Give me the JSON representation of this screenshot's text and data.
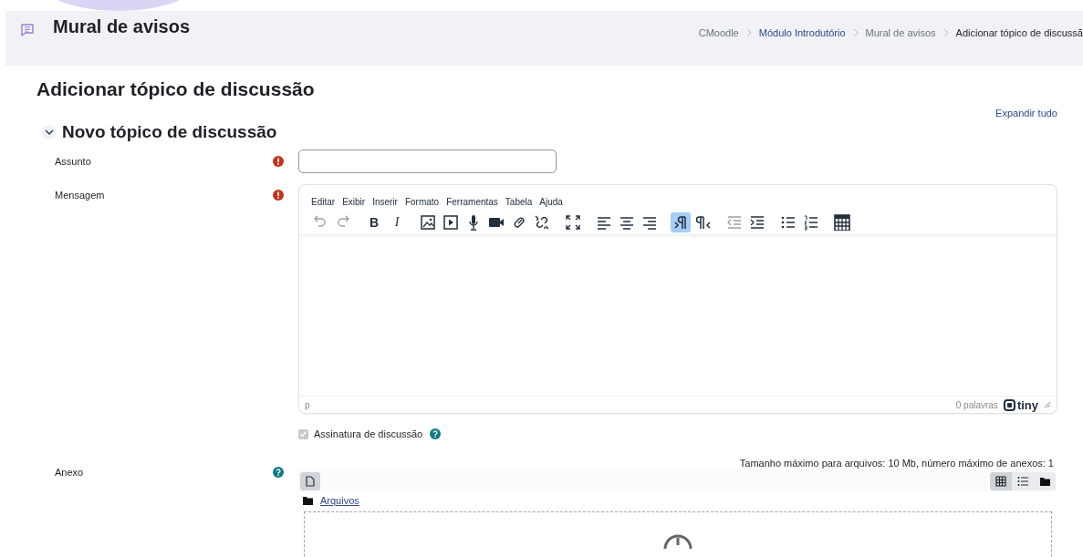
{
  "page_header": {
    "title": "Mural de avisos",
    "breadcrumb": [
      {
        "label": "CMoodle",
        "kind": "plain"
      },
      {
        "label": "Módulo Introdutório",
        "kind": "link"
      },
      {
        "label": "Mural de avisos",
        "kind": "plain"
      },
      {
        "label": "Adicionar tópico de discussã",
        "kind": "current"
      }
    ]
  },
  "heading": "Adicionar tópico de discussão",
  "expand_all": "Expandir tudo",
  "section": {
    "title": "Novo tópico de discussão",
    "expanded": true
  },
  "subject": {
    "label": "Assunto",
    "required": true
  },
  "message": {
    "label": "Mensagem",
    "required": true,
    "menus": [
      "Editar",
      "Exibir",
      "Inserir",
      "Formato",
      "Ferramentas",
      "Tabela",
      "Ajuda"
    ],
    "toolbar": [
      [
        {
          "kind": "undo",
          "disabled": true
        },
        {
          "kind": "redo",
          "disabled": true
        }
      ],
      [
        {
          "kind": "bold",
          "label": "B"
        },
        {
          "kind": "italic",
          "label": "I"
        }
      ],
      [
        {
          "kind": "image"
        },
        {
          "kind": "media"
        },
        {
          "kind": "mic"
        },
        {
          "kind": "video"
        },
        {
          "kind": "link"
        },
        {
          "kind": "unlink"
        }
      ],
      [
        {
          "kind": "fullscreen"
        }
      ],
      [
        {
          "kind": "align-left"
        },
        {
          "kind": "align-center"
        },
        {
          "kind": "align-right"
        }
      ],
      [
        {
          "kind": "ltr",
          "selected": true
        },
        {
          "kind": "rtl",
          "selected": false
        }
      ],
      [
        {
          "kind": "outdent",
          "disabled": true
        },
        {
          "kind": "indent",
          "disabled": false
        }
      ],
      [
        {
          "kind": "bullets"
        },
        {
          "kind": "numbers"
        }
      ],
      [
        {
          "kind": "calculator"
        }
      ]
    ],
    "path": "p",
    "word_count": "0 palavras",
    "brand": "tiny"
  },
  "signature": {
    "label": "Assinatura de discussão",
    "checked": true,
    "disabled": true
  },
  "attachment": {
    "label": "Anexo",
    "limits": "Tamanho máximo para arquivos: 10 Mb, número máximo de anexos: 1",
    "views": [
      {
        "kind": "grid",
        "selected": true
      },
      {
        "kind": "list",
        "selected": false
      },
      {
        "kind": "tree",
        "selected": false
      }
    ],
    "folder": "Arquivos"
  }
}
